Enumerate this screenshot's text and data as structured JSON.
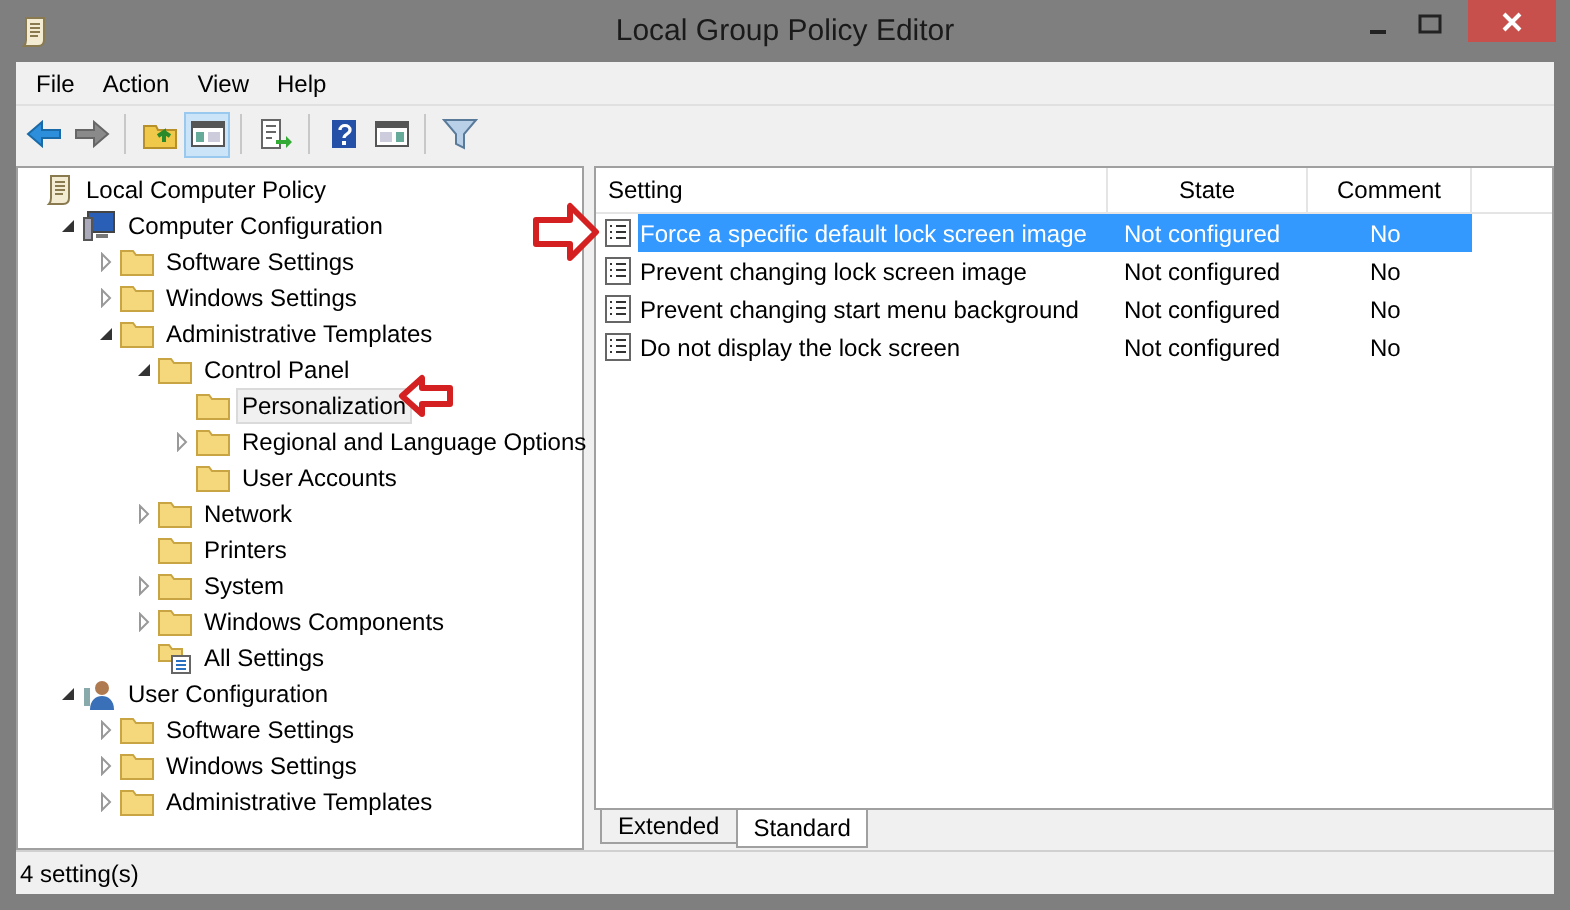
{
  "window": {
    "title": "Local Group Policy Editor"
  },
  "menu": [
    "File",
    "Action",
    "View",
    "Help"
  ],
  "toolbar": [
    {
      "kind": "back"
    },
    {
      "kind": "forward"
    },
    {
      "kind": "sep"
    },
    {
      "kind": "up"
    },
    {
      "kind": "tree",
      "selected": true
    },
    {
      "kind": "sep"
    },
    {
      "kind": "export"
    },
    {
      "kind": "sep"
    },
    {
      "kind": "help"
    },
    {
      "kind": "pane"
    },
    {
      "kind": "sep"
    },
    {
      "kind": "filter"
    }
  ],
  "tree": [
    {
      "label": "Local Computer Policy",
      "kind": "scroll",
      "selected": false,
      "children": [
        {
          "label": "Computer Configuration",
          "kind": "computer",
          "expanded": true,
          "selected": false,
          "children": [
            {
              "label": "Software Settings",
              "kind": "folder",
              "expanded": false,
              "selected": false
            },
            {
              "label": "Windows Settings",
              "kind": "folder",
              "expanded": false,
              "selected": false
            },
            {
              "label": "Administrative Templates",
              "kind": "folder",
              "expanded": true,
              "selected": false,
              "children": [
                {
                  "label": "Control Panel",
                  "kind": "folder",
                  "expanded": true,
                  "selected": false,
                  "children": [
                    {
                      "label": "Personalization",
                      "kind": "folder",
                      "selected": true
                    },
                    {
                      "label": "Regional and Language Options",
                      "kind": "folder",
                      "expanded": false,
                      "selected": false
                    },
                    {
                      "label": "User Accounts",
                      "kind": "folder",
                      "selected": false
                    }
                  ]
                },
                {
                  "label": "Network",
                  "kind": "folder",
                  "expanded": false,
                  "selected": false
                },
                {
                  "label": "Printers",
                  "kind": "folder",
                  "selected": false
                },
                {
                  "label": "System",
                  "kind": "folder",
                  "expanded": false,
                  "selected": false
                },
                {
                  "label": "Windows Components",
                  "kind": "folder",
                  "expanded": false,
                  "selected": false
                },
                {
                  "label": "All Settings",
                  "kind": "settings",
                  "selected": false
                }
              ]
            }
          ]
        },
        {
          "label": "User Configuration",
          "kind": "user",
          "expanded": true,
          "selected": false,
          "children": [
            {
              "label": "Software Settings",
              "kind": "folder",
              "expanded": false,
              "selected": false
            },
            {
              "label": "Windows Settings",
              "kind": "folder",
              "expanded": false,
              "selected": false
            },
            {
              "label": "Administrative Templates",
              "kind": "folder",
              "expanded": false,
              "selected": false
            }
          ]
        }
      ]
    }
  ],
  "table": {
    "columns": [
      "Setting",
      "State",
      "Comment"
    ],
    "rows": [
      {
        "setting": "Force a specific default lock screen image",
        "state": "Not configured",
        "comment": "No",
        "selected": true
      },
      {
        "setting": "Prevent changing lock screen image",
        "state": "Not configured",
        "comment": "No",
        "selected": false
      },
      {
        "setting": "Prevent changing start menu background",
        "state": "Not configured",
        "comment": "No",
        "selected": false
      },
      {
        "setting": "Do not display the lock screen",
        "state": "Not configured",
        "comment": "No",
        "selected": false
      }
    ]
  },
  "tabs": [
    {
      "label": "Extended",
      "selected": false
    },
    {
      "label": "Standard",
      "selected": true
    }
  ],
  "status_bar": "4 setting(s)"
}
